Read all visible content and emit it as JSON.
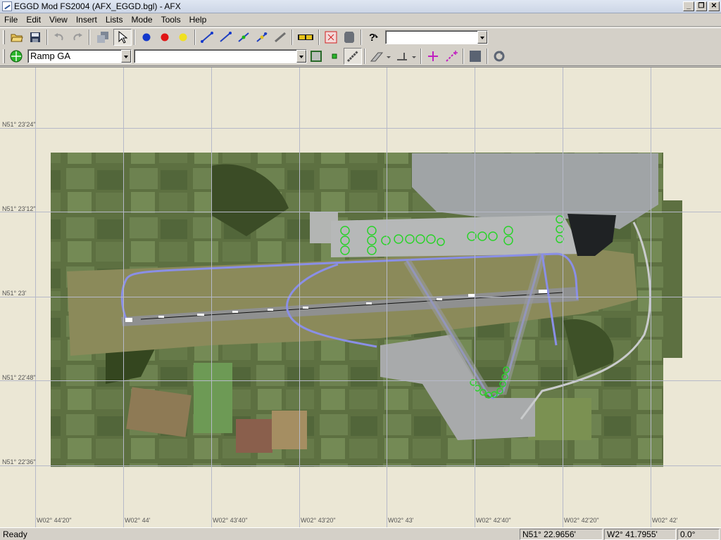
{
  "window": {
    "title": "EGGD Mod FS2004 (AFX_EGGD.bgl) - AFX",
    "buttons": [
      "_",
      "❐",
      "✕"
    ]
  },
  "menu": [
    "File",
    "Edit",
    "View",
    "Insert",
    "Lists",
    "Mode",
    "Tools",
    "Help"
  ],
  "toolbar1": {
    "icons": [
      "open-icon",
      "save-icon",
      "undo-icon",
      "redo-icon",
      "layer-icon",
      "select-arrow-icon",
      "blue-dot-icon",
      "red-dot-icon",
      "yellow-dot-icon",
      "link-blue-icon",
      "link-blue2-icon",
      "link-green-icon",
      "link-node-icon",
      "link-gray-icon",
      "taxi-sign-icon",
      "delete-box-icon",
      "apron-icon",
      "help-icon"
    ],
    "dropdown_value": ""
  },
  "toolbar2": {
    "type_combo": "Ramp GA",
    "name_combo": ""
  },
  "map": {
    "lat_labels": [
      "N51° 23'24\"",
      "N51° 23'12\"",
      "N51° 23'",
      "N51° 22'48\"",
      "N51° 22'36\""
    ],
    "lon_labels": [
      "W02° 44'20\"",
      "W02° 44'",
      "W02° 43'40\"",
      "W02° 43'20\"",
      "W02° 43'",
      "W02° 42'40\"",
      "W02° 42'20\"",
      "W02° 42'"
    ]
  },
  "status": {
    "ready": "Ready",
    "latitude": "N51° 22.9656'",
    "longitude": "W2° 41.7955'",
    "heading": "0.0°"
  },
  "colors": {
    "grass": "#5e7440",
    "taxiway": "#8a8fe6",
    "runway": "#8c8d8e",
    "parking": "#27c927"
  }
}
